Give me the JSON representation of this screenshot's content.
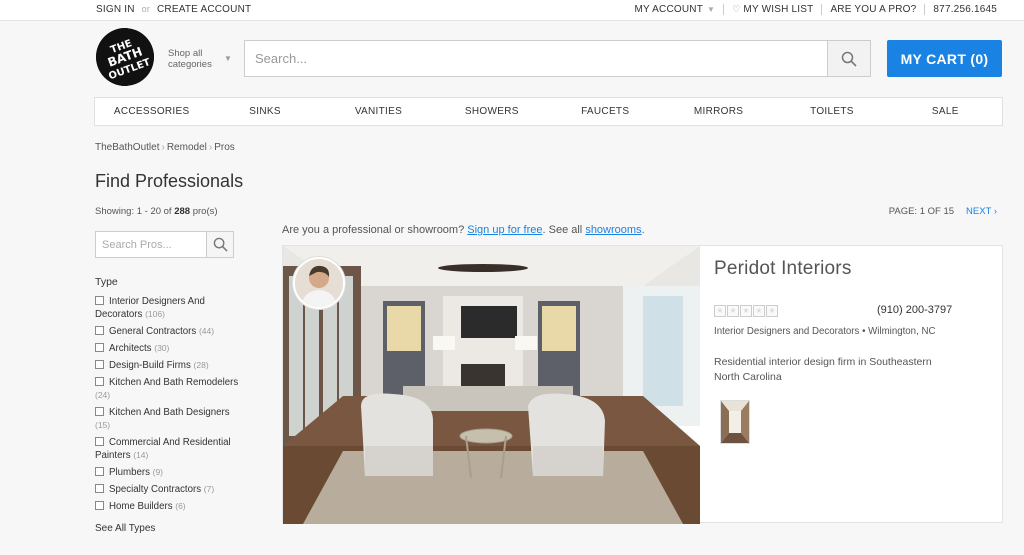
{
  "topbar": {
    "sign_in": "SIGN IN",
    "or": "or",
    "create_account": "CREATE ACCOUNT",
    "my_account": "MY ACCOUNT",
    "wish_list": "MY WISH LIST",
    "are_you_pro": "ARE YOU A PRO?",
    "phone": "877.256.1645"
  },
  "header": {
    "logo_text": "THE BATH OUTLET",
    "shop_all_line1": "Shop all",
    "shop_all_line2": "categories",
    "search_placeholder": "Search...",
    "cart_label": "MY CART (0)"
  },
  "nav": [
    "ACCESSORIES",
    "SINKS",
    "VANITIES",
    "SHOWERS",
    "FAUCETS",
    "MIRRORS",
    "TOILETS",
    "SALE"
  ],
  "breadcrumb": [
    "TheBathOutlet",
    "Remodel",
    "Pros"
  ],
  "page_title": "Find Professionals",
  "showing": {
    "prefix": "Showing: 1 - 20 of",
    "total": "288",
    "suffix": "pro(s)"
  },
  "pagination": {
    "page": "PAGE: 1 OF 15",
    "next": "NEXT ›"
  },
  "pro_note": {
    "text1": "Are you a professional or showroom?",
    "signup": "Sign up for free",
    "text2": ". See all",
    "showrooms": "showrooms",
    "text3": "."
  },
  "sidebar": {
    "search_placeholder": "Search Pros...",
    "type_heading": "Type",
    "filters": [
      {
        "label": "Interior Designers And Decorators",
        "count": "(106)"
      },
      {
        "label": "General Contractors",
        "count": "(44)"
      },
      {
        "label": "Architects",
        "count": "(30)"
      },
      {
        "label": "Design-Build Firms",
        "count": "(28)"
      },
      {
        "label": "Kitchen And Bath Remodelers",
        "count": "(24)"
      },
      {
        "label": "Kitchen And Bath Designers",
        "count": "(15)"
      },
      {
        "label": "Commercial And Residential Painters",
        "count": "(14)"
      },
      {
        "label": "Plumbers",
        "count": "(9)"
      },
      {
        "label": "Specialty Contractors",
        "count": "(7)"
      },
      {
        "label": "Home Builders",
        "count": "(6)"
      }
    ],
    "see_all": "See All Types"
  },
  "listing": {
    "name": "Peridot Interiors",
    "rating": 0,
    "rating_max": 5,
    "phone": "(910) 200-3797",
    "category_location": "Interior Designers and Decorators • Wilmington, NC",
    "description": "Residential interior design firm in Southeastern North Carolina"
  },
  "colors": {
    "accent": "#1a82e2",
    "background": "#f7f7f7"
  }
}
